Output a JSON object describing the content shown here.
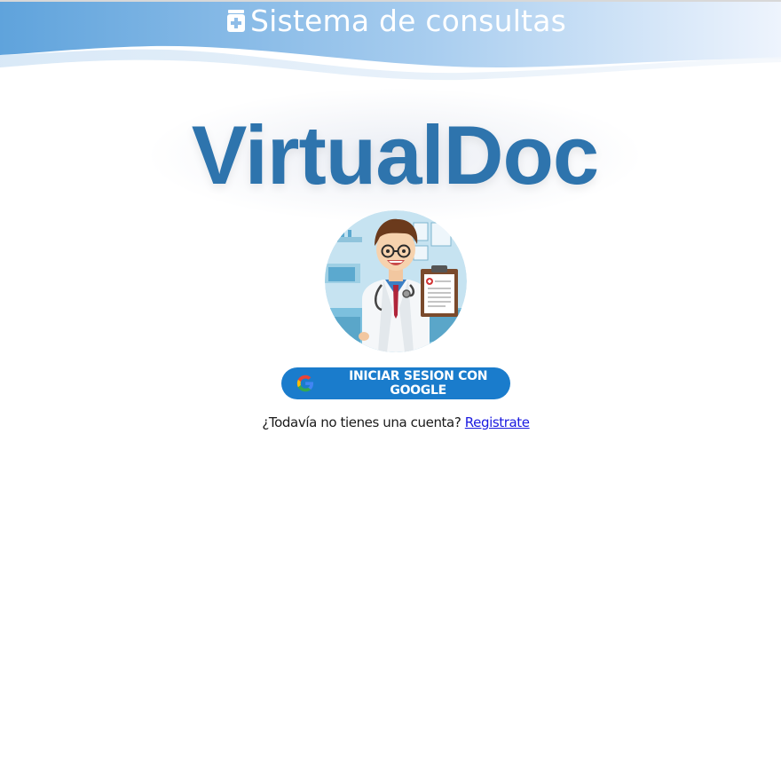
{
  "header": {
    "title": "Sistema de consultas",
    "icon": "medical-kit-icon"
  },
  "brand": {
    "name": "VirtualDoc",
    "color": "#2e74ad"
  },
  "avatar": {
    "icon": "doctor-illustration"
  },
  "login": {
    "google_button_label": "INICIAR SESION CON GOOGLE",
    "button_color": "#1a7ccc",
    "icon": "google-icon"
  },
  "register": {
    "prompt": "¿Todavía no tienes una cuenta?",
    "link_label": "Registrate"
  }
}
